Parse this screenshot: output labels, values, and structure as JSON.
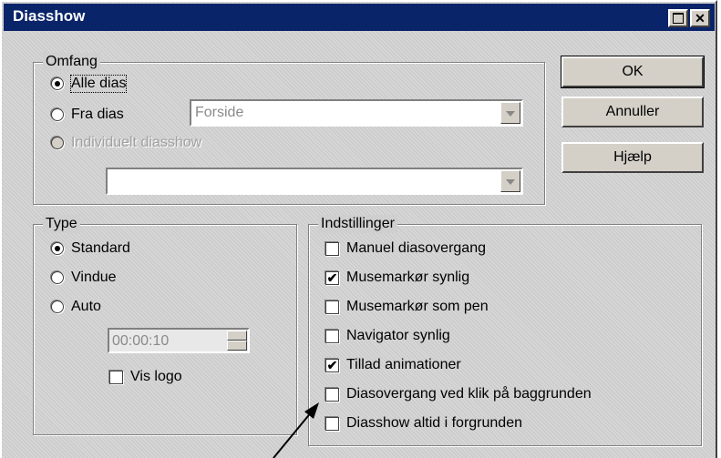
{
  "dialog": {
    "title": "Diasshow"
  },
  "scope": {
    "legend": "Omfang",
    "all_slides": "Alle dias",
    "from_slide": "Fra dias",
    "custom_show": "Individuelt diasshow",
    "from_slide_value": "Forside",
    "custom_show_value": ""
  },
  "type": {
    "legend": "Type",
    "standard": "Standard",
    "window": "Vindue",
    "auto": "Auto",
    "pause": "00:00:10",
    "show_logo": "Vis logo"
  },
  "settings": {
    "legend": "Indstillinger",
    "items": [
      {
        "label": "Manuel diasovergang",
        "checked": false
      },
      {
        "label": "Musemarkør synlig",
        "checked": true
      },
      {
        "label": "Musemarkør som pen",
        "checked": false
      },
      {
        "label": "Navigator synlig",
        "checked": false
      },
      {
        "label": "Tillad animationer",
        "checked": true
      },
      {
        "label": "Diasovergang ved klik på baggrunden",
        "checked": false
      },
      {
        "label": "Diasshow altid i forgrunden",
        "checked": false
      }
    ]
  },
  "buttons": {
    "ok": "OK",
    "cancel": "Annuller",
    "help": "Hjælp"
  }
}
